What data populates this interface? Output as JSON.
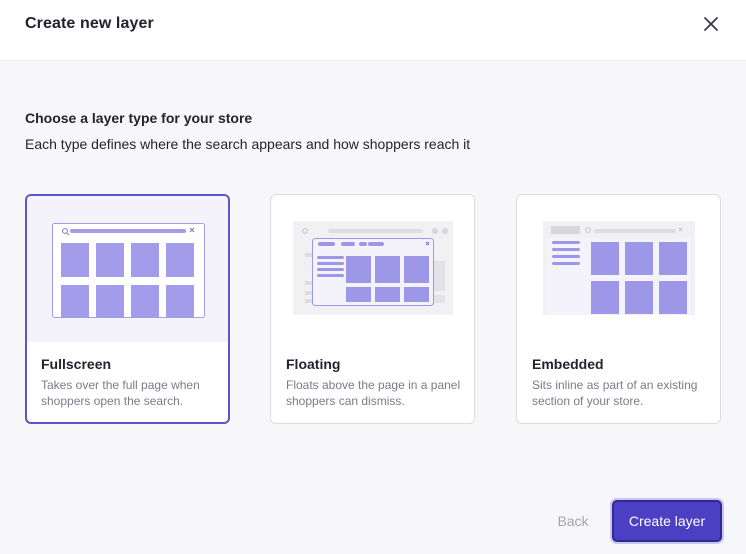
{
  "dialog": {
    "title": "Create new layer",
    "close_icon": "close-icon"
  },
  "intro": {
    "heading": "Choose a layer type for your store",
    "subheading": "Each type defines where the search appears and how shoppers reach it"
  },
  "layer_types": [
    {
      "name": "Fullscreen",
      "description": "Takes over the full page when shoppers open the search.",
      "selected": true
    },
    {
      "name": "Floating",
      "description": "Floats above the page in a panel shoppers can dismiss.",
      "selected": false
    },
    {
      "name": "Embedded",
      "description": "Sits inline as part of an existing section of your store.",
      "selected": false
    }
  ],
  "footer": {
    "back_label": "Back",
    "create_label": "Create layer"
  },
  "colors": {
    "accent": "#4b3fc4",
    "tile": "#a29cea",
    "tile_dark": "#9d97e8"
  }
}
